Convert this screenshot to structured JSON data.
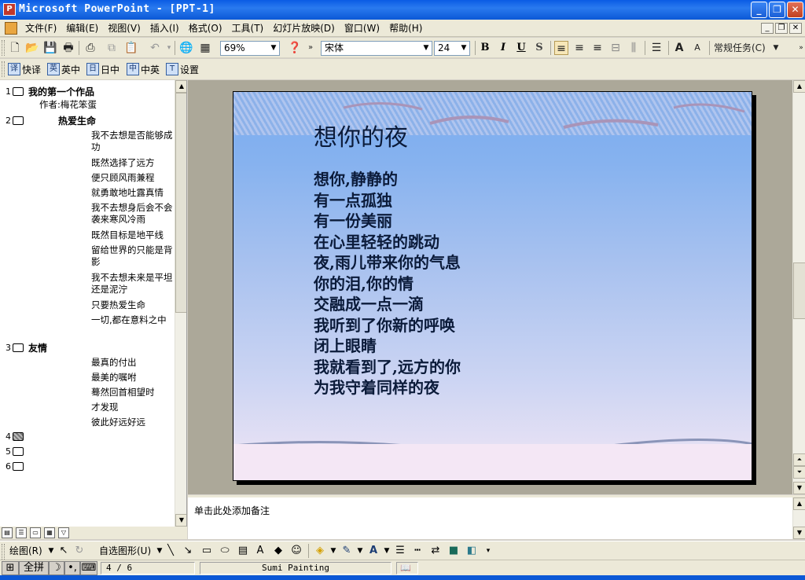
{
  "window": {
    "title": "Microsoft PowerPoint - [PPT-1]",
    "app_icon_letter": "P",
    "accent_color": "#0b58d6"
  },
  "menubar": {
    "items": [
      "文件(F)",
      "编辑(E)",
      "视图(V)",
      "插入(I)",
      "格式(O)",
      "工具(T)",
      "幻灯片放映(D)",
      "窗口(W)",
      "帮助(H)"
    ]
  },
  "toolbar": {
    "zoom": "69%",
    "font_name": "宋体",
    "font_size": "24",
    "bold": "B",
    "italic": "I",
    "underline": "U",
    "shadow": "S",
    "task_pane": "常规任务(C)"
  },
  "toolbar2": {
    "items": [
      "快译",
      "英中",
      "日中",
      "中英",
      "设置"
    ]
  },
  "outline": {
    "slides": [
      {
        "num": "1",
        "title": "我的第一个作品",
        "subtitle": "作者:梅花笨蛋",
        "body": []
      },
      {
        "num": "2",
        "title": "热爱生命",
        "body": [
          "我不去想是否能够成功",
          "既然选择了远方",
          "便只顾风雨兼程",
          "就勇敢地吐露真情",
          "我不去想身后会不会袭来寒风冷雨",
          "既然目标是地平线",
          "留给世界的只能是背影",
          "我不去想未来是平坦还是泥泞",
          "只要热爱生命",
          "一切,都在意料之中"
        ]
      },
      {
        "num": "3",
        "title": "友情",
        "body": [
          "最真的付出",
          "最美的嘱咐",
          "蓦然回首相望时",
          "才发现",
          "彼此好远好远"
        ]
      },
      {
        "num": "4",
        "title": "",
        "body": []
      },
      {
        "num": "5",
        "title": "",
        "body": []
      },
      {
        "num": "6",
        "title": "",
        "body": []
      }
    ]
  },
  "slide": {
    "title": "想你的夜",
    "lines": [
      "想你,静静的",
      "有一点孤独",
      "有一份美丽",
      "在心里轻轻的跳动",
      "夜,雨儿带来你的气息",
      "你的泪,你的情",
      "交融成一点一滴",
      "我听到了你新的呼唤",
      "闭上眼睛",
      "我就看到了,远方的你",
      "为我守着同样的夜"
    ]
  },
  "notes": {
    "placeholder": "单击此处添加备注"
  },
  "drawbar": {
    "draw": "绘图(R)",
    "autoshapes": "自选图形(U)"
  },
  "statusbar": {
    "ime_mode": "全拼",
    "slide_position": "4 / 6",
    "design_template": "Sumi Painting"
  }
}
